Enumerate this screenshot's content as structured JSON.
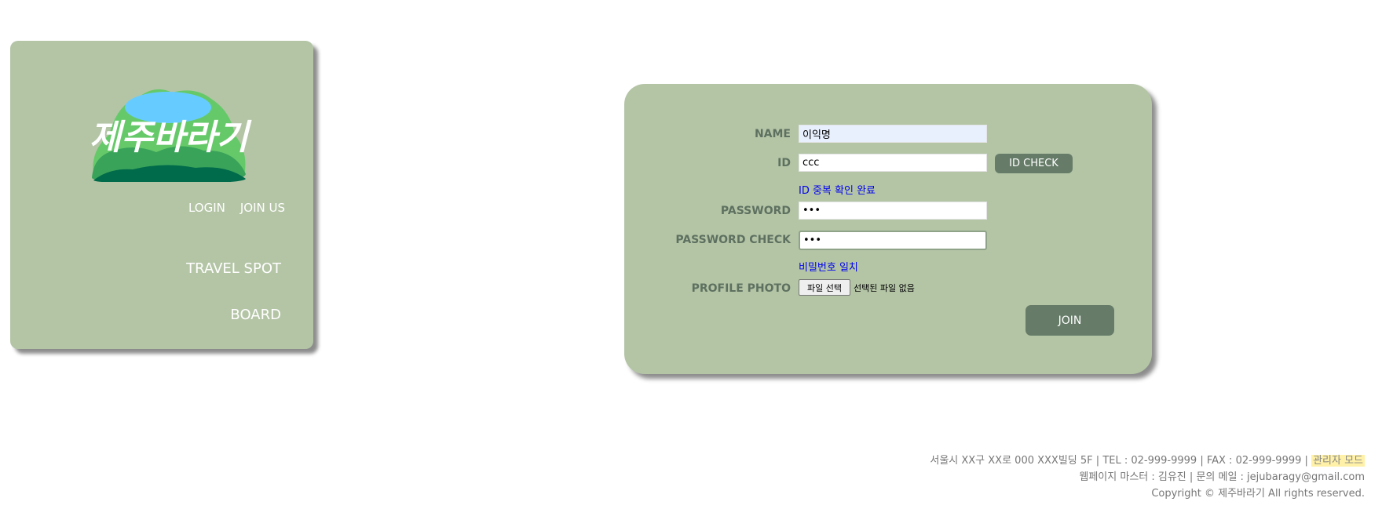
{
  "logo": {
    "text": "제주바라기",
    "colors": {
      "lake": "#66ccff",
      "hill_light": "#66c969",
      "hill_mid": "#3aa35a",
      "hill_dark": "#006b4a"
    }
  },
  "header_links": {
    "login": "LOGIN",
    "join": "JOIN US"
  },
  "nav": {
    "travel": "TRAVEL SPOT",
    "board": "BOARD"
  },
  "form": {
    "name_label": "NAME",
    "name_value": "이익명",
    "id_label": "ID",
    "id_value": "ccc",
    "id_check_label": "ID CHECK",
    "id_check_message": "ID 중복 확인 완료",
    "password_label": "PASSWORD",
    "password_value": "•••",
    "password_check_label": "PASSWORD CHECK",
    "password_check_value": "•••",
    "password_match_message": "비밀번호 일치",
    "profile_label": "PROFILE PHOTO",
    "file_button": "파일 선택",
    "file_status": "선택된 파일 없음",
    "join_label": "JOIN"
  },
  "footer": {
    "address": "서울시 XX구 XX로 000 XXX빌딩 5F",
    "tel": "TEL : 02-999-9999",
    "fax": "FAX : 02-999-9999",
    "admin": "관리자 모드",
    "webmaster": "웹페이지 마스터 : 김유진",
    "contact": "문의 메일 : jejubaragy@gmail.com",
    "copyright": "Copyright © 제주바라기 All rights reserved."
  },
  "colors": {
    "panel": "#b4c5a6",
    "button": "#667c68",
    "label": "#5e7160",
    "message": "#0000ee"
  }
}
